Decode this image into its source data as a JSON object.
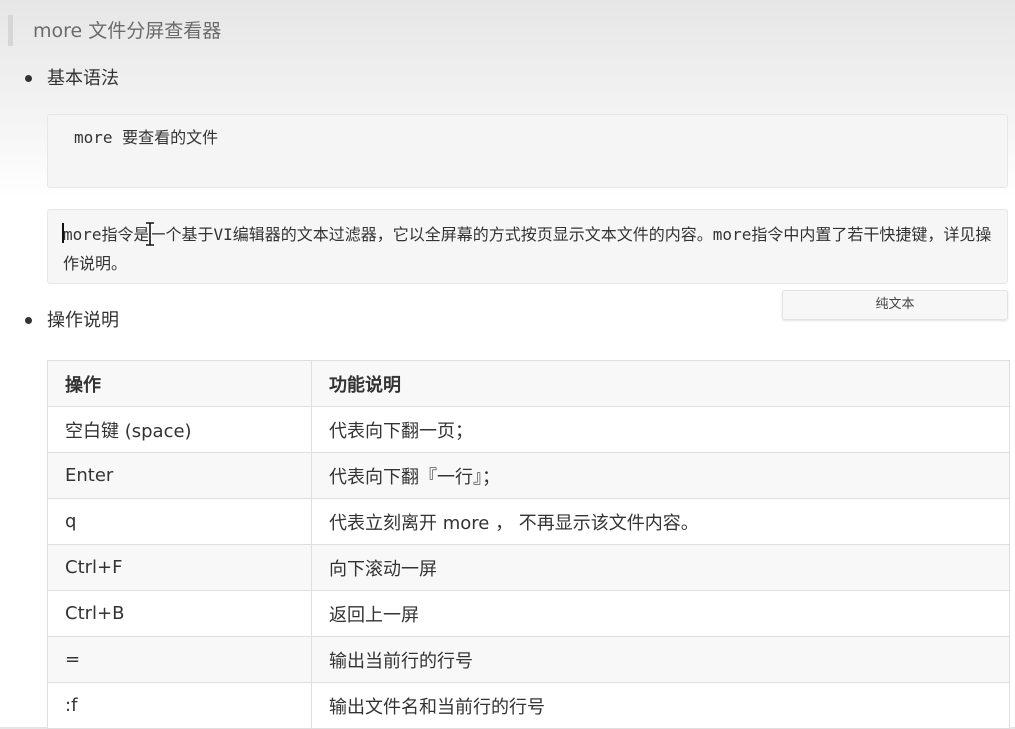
{
  "heading": "more 文件分屏查看器",
  "syntax": {
    "label": "基本语法",
    "code": "more 要查看的文件"
  },
  "description": {
    "text": "more指令是一个基于VI编辑器的文本过滤器，它以全屏幕的方式按页显示文本文件的内容。more指令中内置了若干快捷键，详见操作说明。"
  },
  "plain_text_button": "纯文本",
  "operations": {
    "label": "操作说明",
    "headers": [
      "操作",
      "功能说明"
    ],
    "rows": [
      [
        "空白键 (space)",
        "代表向下翻一页；"
      ],
      [
        "Enter",
        "代表向下翻『一行』；"
      ],
      [
        "q",
        "代表立刻离开 more ， 不再显示该文件内容。"
      ],
      [
        "Ctrl+F",
        "向下滚动一屏"
      ],
      [
        "Ctrl+B",
        "返回上一屏"
      ],
      [
        "=",
        "输出当前行的行号"
      ],
      [
        ":f",
        "输出文件名和当前行的行号"
      ]
    ]
  }
}
